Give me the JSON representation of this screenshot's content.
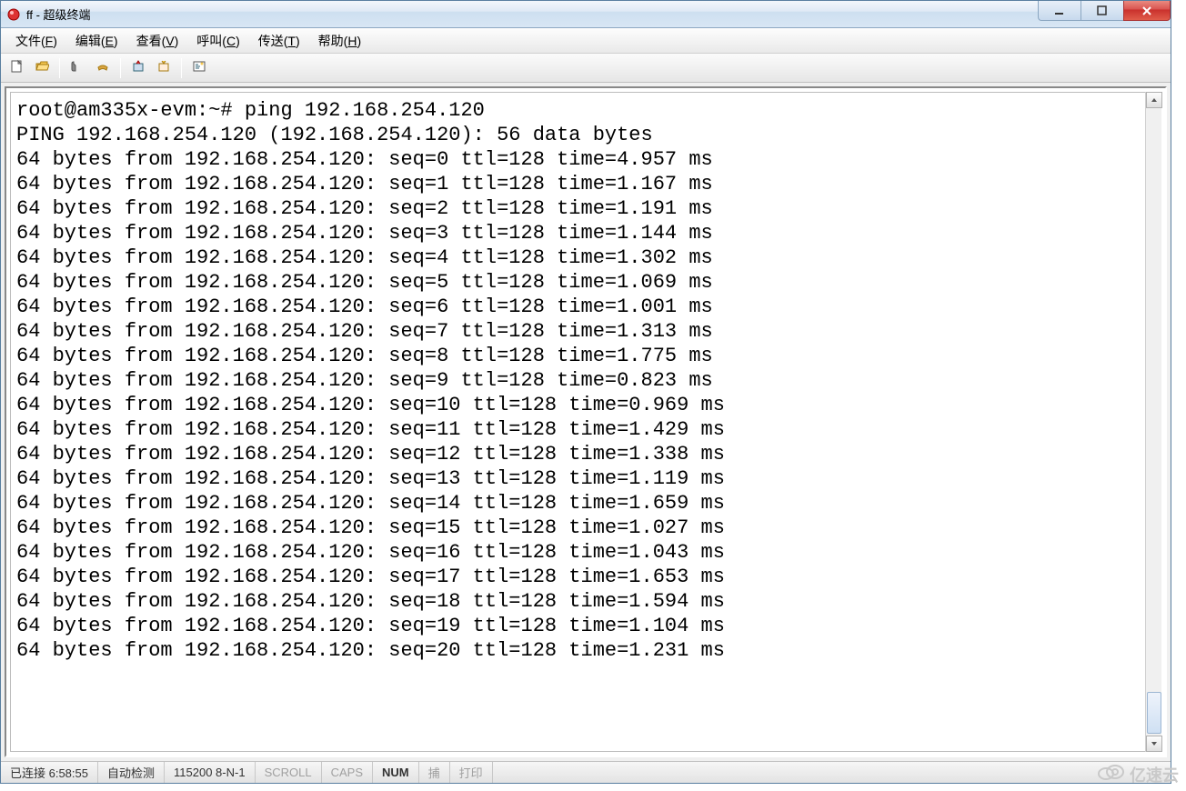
{
  "window": {
    "title": "ff - 超级终端",
    "buttons": {
      "min": "minimize",
      "max": "maximize",
      "close": "close"
    }
  },
  "menu": {
    "file": {
      "label": "文件",
      "accel": "F"
    },
    "edit": {
      "label": "编辑",
      "accel": "E"
    },
    "view": {
      "label": "查看",
      "accel": "V"
    },
    "call": {
      "label": "呼叫",
      "accel": "C"
    },
    "send": {
      "label": "传送",
      "accel": "T"
    },
    "help": {
      "label": "帮助",
      "accel": "H"
    }
  },
  "toolbar": {
    "new": "new-file",
    "open": "open-file",
    "connect": "connect",
    "disconnect": "disconnect",
    "send": "send-file",
    "receive": "receive-file",
    "props": "properties"
  },
  "terminal": {
    "prompt": "root@am335x-evm:~# ping 192.168.254.120",
    "header": "PING 192.168.254.120 (192.168.254.120): 56 data bytes",
    "lines": [
      "64 bytes from 192.168.254.120: seq=0 ttl=128 time=4.957 ms",
      "64 bytes from 192.168.254.120: seq=1 ttl=128 time=1.167 ms",
      "64 bytes from 192.168.254.120: seq=2 ttl=128 time=1.191 ms",
      "64 bytes from 192.168.254.120: seq=3 ttl=128 time=1.144 ms",
      "64 bytes from 192.168.254.120: seq=4 ttl=128 time=1.302 ms",
      "64 bytes from 192.168.254.120: seq=5 ttl=128 time=1.069 ms",
      "64 bytes from 192.168.254.120: seq=6 ttl=128 time=1.001 ms",
      "64 bytes from 192.168.254.120: seq=7 ttl=128 time=1.313 ms",
      "64 bytes from 192.168.254.120: seq=8 ttl=128 time=1.775 ms",
      "64 bytes from 192.168.254.120: seq=9 ttl=128 time=0.823 ms",
      "64 bytes from 192.168.254.120: seq=10 ttl=128 time=0.969 ms",
      "64 bytes from 192.168.254.120: seq=11 ttl=128 time=1.429 ms",
      "64 bytes from 192.168.254.120: seq=12 ttl=128 time=1.338 ms",
      "64 bytes from 192.168.254.120: seq=13 ttl=128 time=1.119 ms",
      "64 bytes from 192.168.254.120: seq=14 ttl=128 time=1.659 ms",
      "64 bytes from 192.168.254.120: seq=15 ttl=128 time=1.027 ms",
      "64 bytes from 192.168.254.120: seq=16 ttl=128 time=1.043 ms",
      "64 bytes from 192.168.254.120: seq=17 ttl=128 time=1.653 ms",
      "64 bytes from 192.168.254.120: seq=18 ttl=128 time=1.594 ms",
      "64 bytes from 192.168.254.120: seq=19 ttl=128 time=1.104 ms",
      "64 bytes from 192.168.254.120: seq=20 ttl=128 time=1.231 ms"
    ]
  },
  "status": {
    "connected": "已连接 6:58:55",
    "detect": "自动检测",
    "baud": "115200 8-N-1",
    "scroll": "SCROLL",
    "caps": "CAPS",
    "num": "NUM",
    "capture": "捕",
    "print": "打印"
  },
  "watermark": {
    "text": "亿速云"
  }
}
